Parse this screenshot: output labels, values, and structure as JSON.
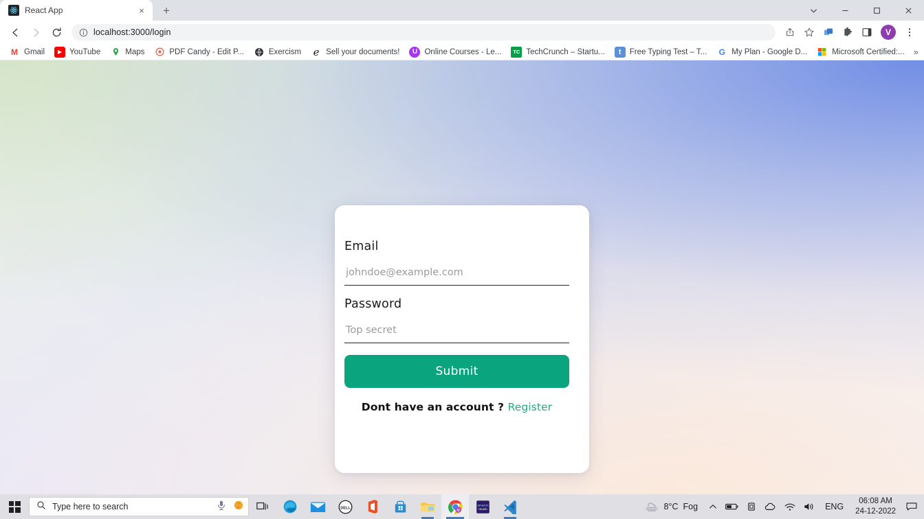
{
  "browser": {
    "tab": {
      "title": "React App",
      "favicon": "react-logo",
      "close_label": "×"
    },
    "new_tab_label": "+",
    "window_controls": {
      "tab_search": "tab-search",
      "minimize": "minimize",
      "maximize": "maximize",
      "close": "close"
    },
    "nav": {
      "back": "back-arrow",
      "forward": "forward-arrow",
      "reload": "reload"
    },
    "omnibox": {
      "url": "localhost:3000/login",
      "info_icon": "site-info-icon"
    },
    "toolbar_icons": [
      "share-icon",
      "bookmark-star-icon",
      "tab-groups-icon",
      "extensions-icon",
      "side-panel-icon"
    ],
    "profile_initial": "V",
    "menu_icon": "three-dot-menu-icon",
    "bookmarks": [
      {
        "label": "Gmail",
        "icon": "gmail-icon",
        "glyph": "M",
        "color": "#ea4335",
        "bg": "#ffffff"
      },
      {
        "label": "YouTube",
        "icon": "youtube-icon",
        "glyph": "▶",
        "color": "#ffffff",
        "bg": "#ff0000"
      },
      {
        "label": "Maps",
        "icon": "maps-pin-icon",
        "glyph": "●",
        "color": "#34a853",
        "bg": "#ffffff"
      },
      {
        "label": "PDF Candy - Edit P...",
        "icon": "pdf-candy-icon",
        "glyph": "◎",
        "color": "#e8604c",
        "bg": "#ffffff"
      },
      {
        "label": "Exercism",
        "icon": "exercism-icon",
        "glyph": "⊕",
        "color": "#2e2e38",
        "bg": "#ffffff"
      },
      {
        "label": "Sell your documents!",
        "icon": "studocu-icon",
        "glyph": "e",
        "color": "#1a1a1a",
        "bg": "#ffffff"
      },
      {
        "label": "Online Courses - Le...",
        "icon": "udemy-icon",
        "glyph": "ⓤ",
        "color": "#ffffff",
        "bg": "#a435f0"
      },
      {
        "label": "TechCrunch – Startu...",
        "icon": "techcrunch-icon",
        "glyph": "TC",
        "color": "#ffffff",
        "bg": "#0a9e4a"
      },
      {
        "label": "Free Typing Test – T...",
        "icon": "typing-test-icon",
        "glyph": "t",
        "color": "#ffffff",
        "bg": "#5b8fd6"
      },
      {
        "label": "My Plan - Google D...",
        "icon": "google-drive-icon",
        "glyph": "G",
        "color": "#4285f4",
        "bg": "#ffffff"
      },
      {
        "label": "Microsoft Certified:...",
        "icon": "microsoft-icon",
        "glyph": "⊞",
        "color": "#f25022",
        "bg": "#ffffff"
      }
    ],
    "bookmarks_overflow_label": "»"
  },
  "page": {
    "email": {
      "label": "Email",
      "placeholder": "johndoe@example.com",
      "value": ""
    },
    "password": {
      "label": "Password",
      "placeholder": "Top secret",
      "value": ""
    },
    "submit_label": "Submit",
    "register_prompt": "Dont have an account ?",
    "register_link": "Register",
    "accent_color": "#0aa47f",
    "link_color": "#2aa882"
  },
  "taskbar": {
    "start_label": "start-button",
    "search_placeholder": "Type here to search",
    "search_icon": "search-icon",
    "cortana_icon": "cortana-microphone-icon",
    "meet_now_icon": "meet-now-icon",
    "task_view_icon": "task-view-icon",
    "apps": [
      {
        "name": "edge",
        "label": "Microsoft Edge",
        "running": false
      },
      {
        "name": "mail",
        "label": "Mail",
        "running": false
      },
      {
        "name": "dell",
        "label": "Dell",
        "running": false
      },
      {
        "name": "office",
        "label": "Microsoft Office",
        "running": false
      },
      {
        "name": "store",
        "label": "Microsoft Store",
        "running": false
      },
      {
        "name": "file-explorer",
        "label": "File Explorer",
        "running": true
      },
      {
        "name": "chrome",
        "label": "Google Chrome",
        "running": true
      },
      {
        "name": "amazon-music",
        "label": "Amazon Music",
        "running": false
      },
      {
        "name": "vscode",
        "label": "Visual Studio Code",
        "running": true
      }
    ],
    "tray": {
      "weather_temp": "8°C",
      "weather_desc": "Fog",
      "weather_icon": "fog-cloud-icon",
      "chevron_icon": "show-hidden-icons-chevron",
      "battery_icon": "battery-icon",
      "onedrive_icon": "onedrive-icon",
      "cloud_icon": "cloud-icon",
      "network_icon": "wifi-icon",
      "volume_icon": "speaker-icon",
      "language": "ENG",
      "time": "06:08 AM",
      "date": "24-12-2022",
      "action_center_icon": "action-center-icon"
    }
  }
}
